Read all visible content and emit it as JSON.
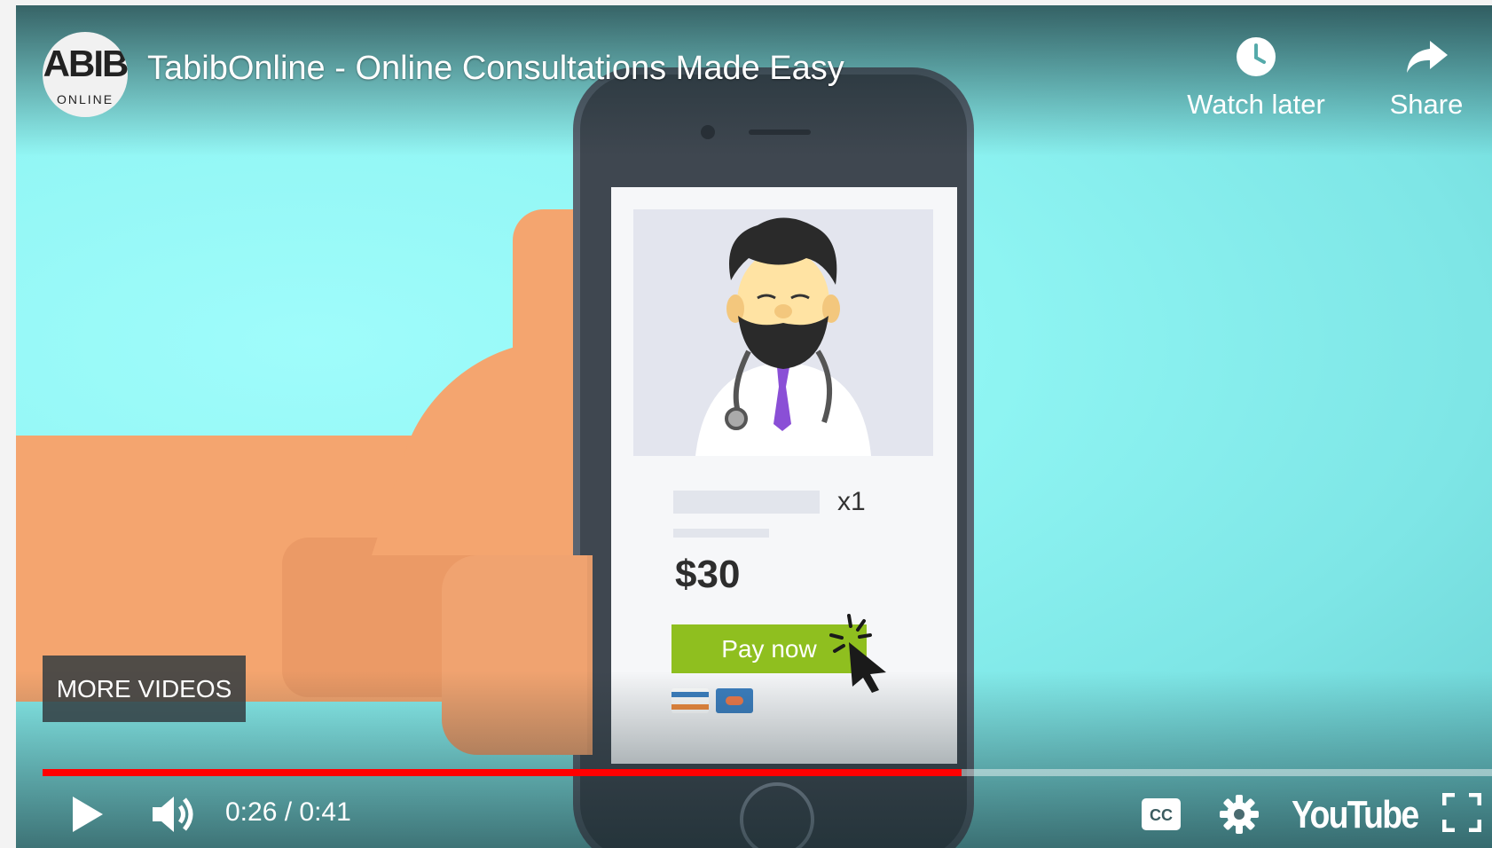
{
  "video": {
    "title": "TabibOnline - Online Consultations Made Easy",
    "channel_logo": {
      "line1": "ABIB",
      "line2": "ONLINE"
    },
    "progress_fraction": 0.634
  },
  "header_actions": {
    "watch_later_label": "Watch later",
    "share_label": "Share"
  },
  "overlay": {
    "more_videos_label": "MORE VIDEOS"
  },
  "frame_content": {
    "qty": "x1",
    "price": "$30",
    "pay_button": "Pay now"
  },
  "controls": {
    "time": "0:26 / 0:41",
    "brand": "YouTube",
    "icons": [
      "play-icon",
      "volume-icon",
      "cc-icon",
      "settings-icon",
      "fullscreen-icon",
      "clock-icon",
      "share-arrow-icon"
    ]
  },
  "colors": {
    "progress": "#ff0000",
    "sky": "#8ff5f3",
    "pay_button": "#8fbf1f"
  }
}
